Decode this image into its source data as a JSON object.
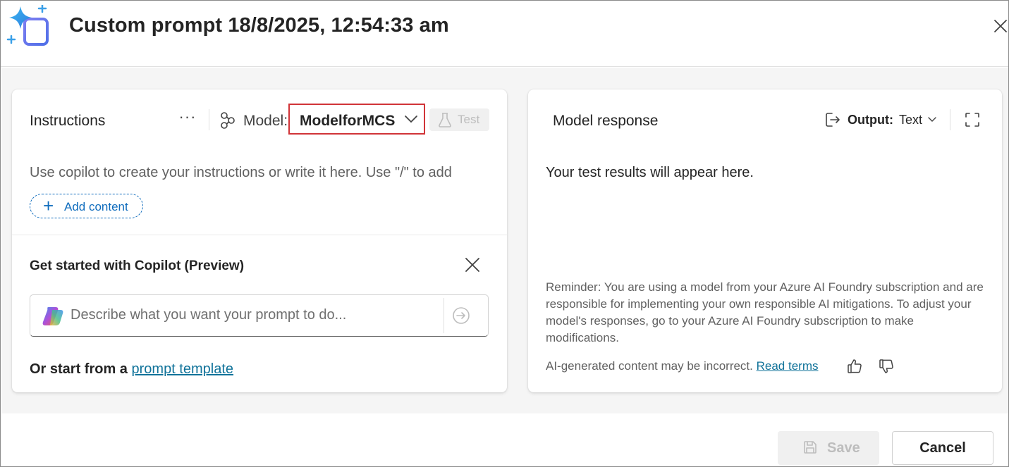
{
  "header": {
    "title": "Custom prompt 18/8/2025, 12:54:33 am",
    "app_icon": "copilot-prompt-icon",
    "close_icon": "close-icon"
  },
  "instructions": {
    "title": "Instructions",
    "more_icon": "more-icon",
    "more_label": "···",
    "model_label": "Model:",
    "model_value": "ModelforMCS",
    "test_label": "Test",
    "placeholder": "Use copilot to create your instructions or write it here. Use \"/\" to add",
    "add_content_label": "Add content"
  },
  "copilot": {
    "title": "Get started with Copilot (Preview)",
    "input_placeholder": "Describe what you want your prompt to do...",
    "start_prefix": "Or start from a",
    "template_link": "prompt template"
  },
  "response": {
    "title": "Model response",
    "output_label": "Output:",
    "output_value": "Text",
    "placeholder": "Your test results will appear here.",
    "reminder": "Reminder: You are using a model from your Azure AI Foundry subscription and are responsible for implementing your own responsible AI mitigations. To adjust your model's responses, go to your Azure AI Foundry subscription to make modifications.",
    "ai_note": "AI-generated content may be incorrect.",
    "read_terms": "Read terms"
  },
  "footer": {
    "save_label": "Save",
    "cancel_label": "Cancel"
  },
  "colors": {
    "accent": "#0f6cbd",
    "highlight_border": "#d13438",
    "link": "#11739a"
  }
}
